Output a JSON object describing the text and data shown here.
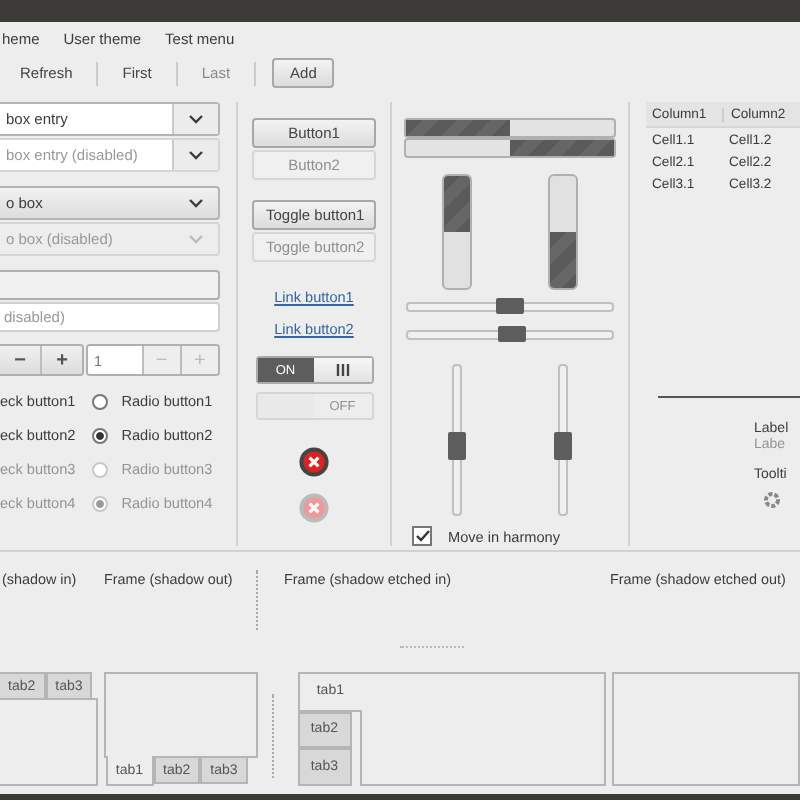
{
  "menu": [
    {
      "label": "heme"
    },
    {
      "label": "User theme"
    },
    {
      "label": "Test menu"
    }
  ],
  "toolbar": [
    {
      "label": "Refresh",
      "disabled": false,
      "kind": "tool"
    },
    {
      "label": "First",
      "disabled": false,
      "kind": "tool"
    },
    {
      "label": "Last",
      "disabled": true,
      "kind": "tool"
    },
    {
      "label": "Add",
      "disabled": false,
      "kind": "button"
    }
  ],
  "combo_entries": [
    {
      "value": "box entry",
      "disabled": false
    },
    {
      "value": "box entry (disabled)",
      "disabled": true
    }
  ],
  "combos": [
    {
      "value": "o box",
      "disabled": false
    },
    {
      "value": "o box (disabled)",
      "disabled": true
    }
  ],
  "entries": [
    {
      "disabled": false
    },
    {
      "value": "disabled)",
      "disabled": true
    }
  ],
  "spin_buttons": [
    {
      "minus": "−",
      "plus": "+"
    },
    {
      "value": "1",
      "minus": "−",
      "plus": "+"
    }
  ],
  "check_buttons": [
    {
      "label": "eck button1",
      "disabled": false
    },
    {
      "label": "eck button2",
      "disabled": false
    },
    {
      "label": "eck button3",
      "disabled": true
    },
    {
      "label": "eck button4",
      "disabled": true
    }
  ],
  "radio_buttons": [
    {
      "label": "Radio button1",
      "selected": false,
      "disabled": false
    },
    {
      "label": "Radio button2",
      "selected": true,
      "disabled": false
    },
    {
      "label": "Radio button3",
      "selected": false,
      "disabled": true
    },
    {
      "label": "Radio button4",
      "selected": true,
      "disabled": true
    }
  ],
  "buttons": [
    {
      "label": "Button1",
      "disabled": false
    },
    {
      "label": "Button2",
      "disabled": true
    },
    {
      "label": "Toggle button1",
      "disabled": false
    },
    {
      "label": "Toggle button2",
      "disabled": true
    }
  ],
  "link_buttons": [
    {
      "label": "Link button1"
    },
    {
      "label": "Link button2"
    }
  ],
  "switches": [
    {
      "label": "ON",
      "on": true,
      "disabled": false
    },
    {
      "label": "OFF",
      "on": false,
      "disabled": true
    }
  ],
  "clear_icons": [
    {
      "disabled": false
    },
    {
      "disabled": true
    }
  ],
  "progress_bars": [
    {
      "level": 0.5,
      "inverted": false
    },
    {
      "level": 0.5,
      "inverted": true
    }
  ],
  "vertical_progress_bars": [
    {
      "level": 0.5,
      "inverted": false
    },
    {
      "level": 0.5,
      "inverted": true
    }
  ],
  "scales": [
    {
      "level": 0.5
    },
    {
      "level": 0.51
    }
  ],
  "vertical_scales": [
    {
      "level": 0.45
    },
    {
      "level": 0.45
    }
  ],
  "harmony": {
    "label": "Move in harmony",
    "checked": true
  },
  "tree": {
    "columns": [
      "Column1",
      "Column2"
    ],
    "rows": [
      [
        "Cell1.1",
        "Cell1.2"
      ],
      [
        "Cell2.1",
        "Cell2.2"
      ],
      [
        "Cell3.1",
        "Cell3.2"
      ]
    ]
  },
  "labels": [
    {
      "label": "Label",
      "disabled": false
    },
    {
      "label": "Labe",
      "disabled": true
    },
    {
      "label": "Toolti",
      "disabled": false
    }
  ],
  "frames": [
    "(shadow in)",
    "Frame (shadow out)",
    "Frame (shadow etched in)",
    "Frame (shadow etched out)"
  ],
  "notebooks": [
    {
      "kind": "top",
      "tabs": [
        {
          "label": "tab2",
          "selected": false
        },
        {
          "label": "tab3",
          "selected": false
        }
      ]
    },
    {
      "kind": "bottom",
      "tabs": [
        {
          "label": "tab1",
          "selected": true
        },
        {
          "label": "tab2",
          "selected": false
        },
        {
          "label": "tab3",
          "selected": false
        }
      ]
    },
    {
      "kind": "left",
      "tabs": [
        {
          "label": "tab1",
          "selected": true
        },
        {
          "label": "tab2",
          "selected": false
        },
        {
          "label": "tab3",
          "selected": false
        }
      ]
    },
    {
      "kind": "right"
    }
  ]
}
